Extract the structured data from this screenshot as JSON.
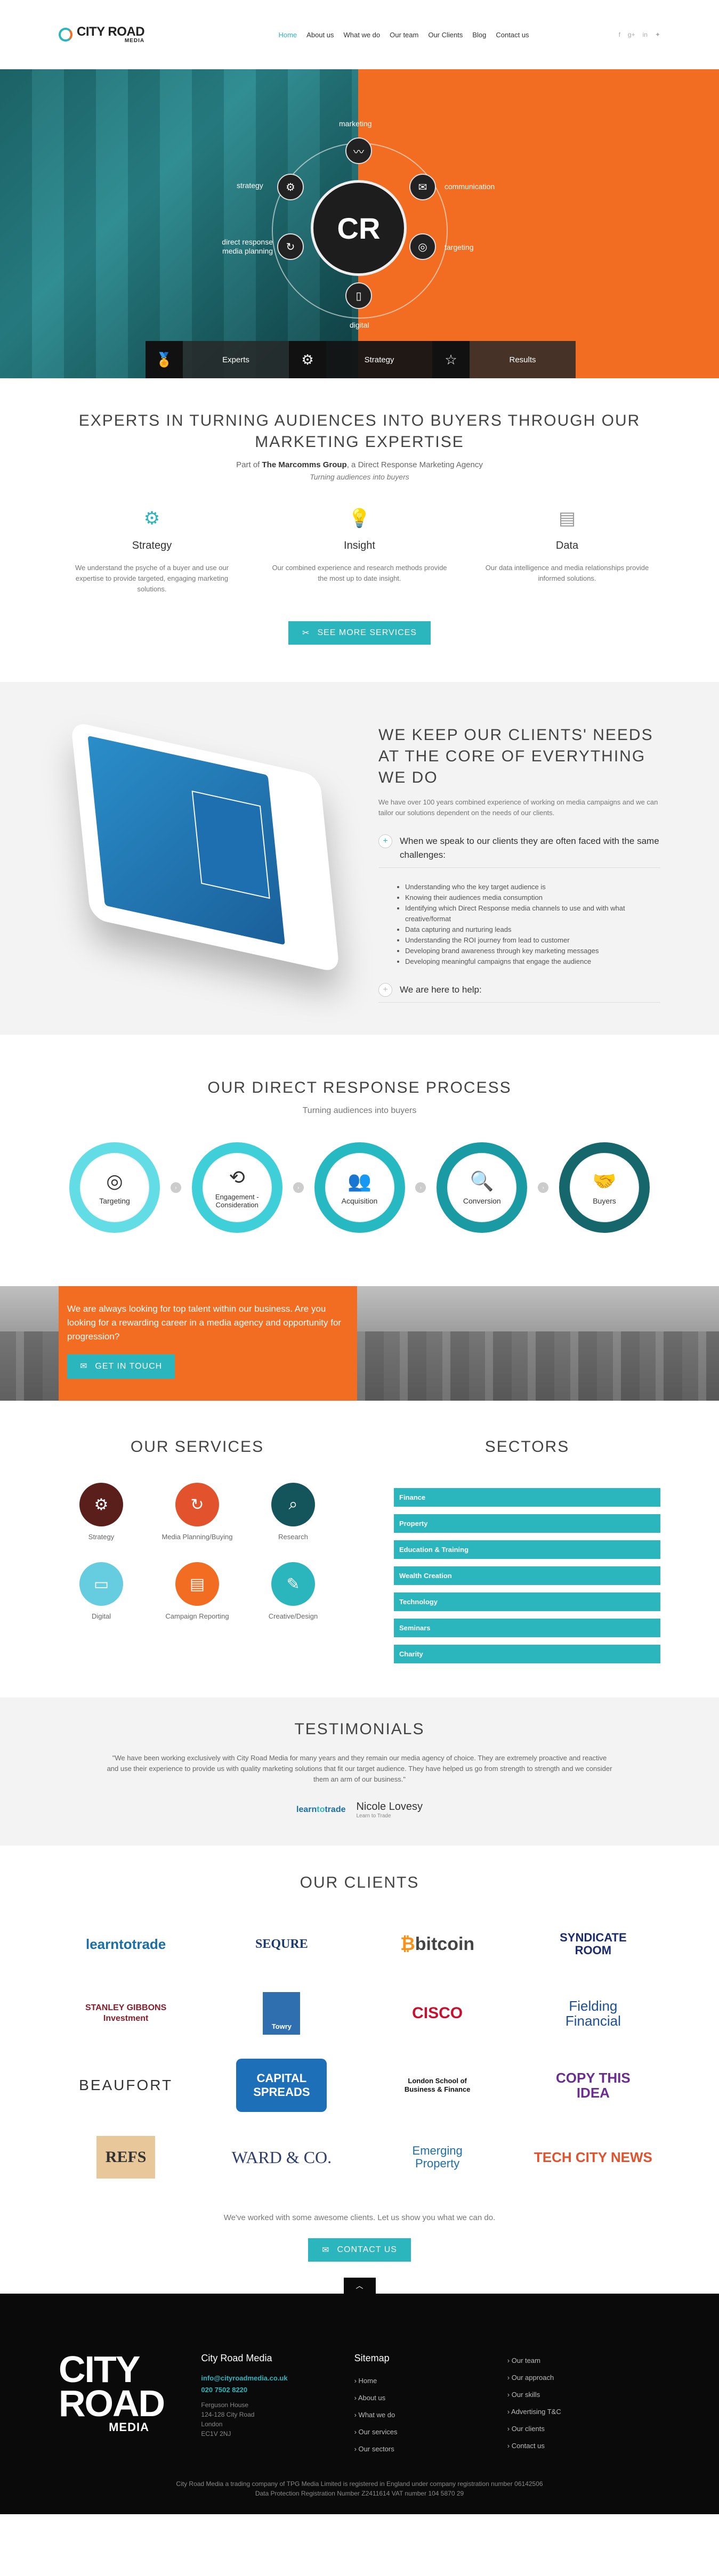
{
  "header": {
    "logo_main": "CITY ROAD",
    "logo_sub": "MEDIA",
    "nav": [
      "Home",
      "About us",
      "What we do",
      "Our team",
      "Our Clients",
      "Blog",
      "Contact us"
    ],
    "social": [
      "f",
      "g+",
      "in",
      "tw"
    ]
  },
  "hero": {
    "center": "CR",
    "labels": {
      "marketing": "marketing",
      "strategy": "strategy",
      "communication": "communication",
      "direct": "direct response media planning",
      "targeting": "targeting",
      "digital": "digital"
    },
    "tabs": [
      "Experts",
      "Strategy",
      "Results"
    ]
  },
  "experts": {
    "title": "EXPERTS IN TURNING AUDIENCES INTO BUYERS THROUGH OUR MARKETING EXPERTISE",
    "sub_pre": "Part of ",
    "sub_bold": "The Marcomms Group",
    "sub_post": ", a Direct Response Marketing Agency",
    "tagline": "Turning audiences into buyers",
    "cols": [
      {
        "title": "Strategy",
        "text": "We understand the psyche of a buyer and use our expertise to provide targeted, engaging marketing solutions."
      },
      {
        "title": "Insight",
        "text": "Our combined experience and research methods provide the most up to date insight."
      },
      {
        "title": "Data",
        "text": "Our data intelligence and media relationships provide informed solutions."
      }
    ],
    "button": "SEE MORE SERVICES"
  },
  "needs": {
    "title": "WE KEEP OUR CLIENTS' NEEDS AT THE CORE OF EVERYTHING WE DO",
    "text": "We have over 100 years combined experience of working on media campaigns and we can tailor our solutions dependent on the needs of our clients.",
    "q1": "When we speak to our clients they are often faced with the same challenges:",
    "bullets": [
      "Understanding who the key target audience is",
      "Knowing their audiences media consumption",
      "Identifying which Direct Response media channels to use and with what creative/format",
      "Data capturing and nurturing leads",
      "Understanding the ROI journey from lead to customer",
      "Developing brand awareness through key marketing messages",
      "Developing meaningful campaigns that engage the audience"
    ],
    "q2": "We are here to help:"
  },
  "process": {
    "title": "OUR DIRECT RESPONSE PROCESS",
    "sub": "Turning audiences into buyers",
    "steps": [
      "Targeting",
      "Engagement - Consideration",
      "Acquisition",
      "Conversion",
      "Buyers"
    ]
  },
  "careers": {
    "text": "We are always looking for top talent within our business. Are you looking for a rewarding career in a media agency and opportunity for progression?",
    "button": "GET IN TOUCH"
  },
  "services": {
    "title": "OUR SERVICES",
    "items": [
      "Strategy",
      "Media Planning/Buying",
      "Research",
      "Digital",
      "Campaign Reporting",
      "Creative/Design"
    ]
  },
  "sectors": {
    "title": "SECTORS",
    "items": [
      "Finance",
      "Property",
      "Education & Training",
      "Wealth Creation",
      "Technology",
      "Seminars",
      "Charity"
    ]
  },
  "testimonials": {
    "title": "TESTIMONIALS",
    "quote": "\"We have been working exclusively with City Road Media for many years and they remain our media agency of choice. They are extremely proactive and reactive and use their experience to provide us with quality marketing solutions that fit our target audience. They have helped us go from strength to strength and we consider them an arm of our business.\"",
    "logo_a": "learn",
    "logo_b": "to",
    "logo_c": "trade",
    "author": "Nicole Lovesy",
    "company": "Learn to Trade"
  },
  "clients": {
    "title": "OUR CLIENTS",
    "logos": [
      "learntotrade",
      "SEQURE",
      "bitcoin",
      "SYNDICATE ROOM",
      "STANLEY GIBBONS Investment",
      "Towry",
      "CISCO",
      "Fielding Financial",
      "BEAUFORT",
      "CAPITAL SPREADS",
      "London School of Business & Finance",
      "COPY THIS IDEA",
      "REFS",
      "WARD & CO.",
      "Emerging Property",
      "TECH CITY NEWS"
    ],
    "more": "We've worked with some awesome clients. Let us show you what we can do.",
    "button": "CONTACT US"
  },
  "footer": {
    "logo_a": "CITY",
    "logo_b": "ROAD",
    "logo_c": "MEDIA",
    "company": "City Road Media",
    "email": "info@cityroadmedia.co.uk",
    "phone": "020 7502 8220",
    "address": [
      "Ferguson House",
      "124-128 City Road",
      "London",
      "EC1V 2NJ"
    ],
    "sitemap_title": "Sitemap",
    "links_a": [
      "Home",
      "About us",
      "What we do",
      "Our services",
      "Our sectors"
    ],
    "links_b": [
      "Our team",
      "Our approach",
      "Our skills",
      "Advertising T&C",
      "Our clients",
      "Contact us"
    ],
    "legal1": "City Road Media a trading company of TPG Media Limited is registered in England under company registration number 06142506",
    "legal2": "Data Protection Registration Number Z2411614 VAT number 104 5870 29"
  },
  "colors": {
    "teal": "#2bb6bd",
    "orange": "#f26c22",
    "dark": "#0a0a0a"
  }
}
